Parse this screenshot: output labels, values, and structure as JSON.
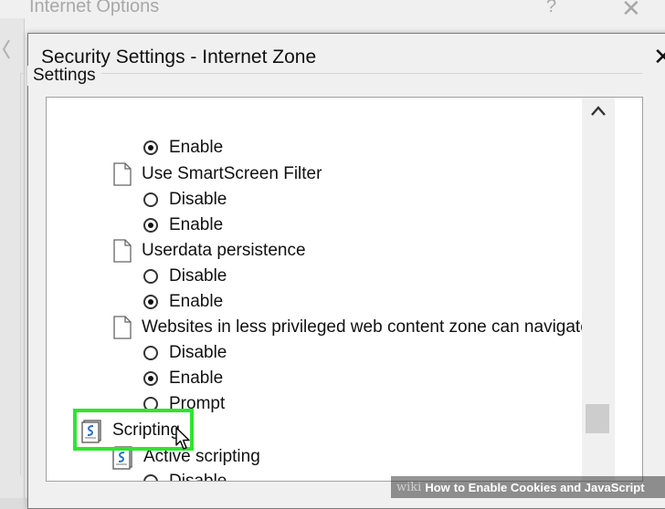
{
  "background_window": {
    "title": "Internet Options",
    "help_glyph": "?",
    "close_glyph": "✕"
  },
  "dialog": {
    "title": "Security Settings - Internet Zone",
    "close_glyph": "✕"
  },
  "settings": {
    "group_label": "Settings",
    "rows": [
      {
        "type": "radio",
        "label": "Enable",
        "checked": true
      },
      {
        "type": "setting",
        "label": "Use SmartScreen Filter"
      },
      {
        "type": "radio",
        "label": "Disable",
        "checked": false
      },
      {
        "type": "radio",
        "label": "Enable",
        "checked": true
      },
      {
        "type": "setting",
        "label": "Userdata persistence"
      },
      {
        "type": "radio",
        "label": "Disable",
        "checked": false
      },
      {
        "type": "radio",
        "label": "Enable",
        "checked": true
      },
      {
        "type": "setting",
        "label": "Websites in less privileged web content zone can navigate in"
      },
      {
        "type": "radio",
        "label": "Disable",
        "checked": false
      },
      {
        "type": "radio",
        "label": "Enable",
        "checked": true
      },
      {
        "type": "radio",
        "label": "Prompt",
        "checked": false
      },
      {
        "type": "category",
        "label": "Scripting"
      },
      {
        "type": "setting",
        "label": "Active scripting"
      },
      {
        "type": "radio",
        "label": "Disable",
        "checked": false
      }
    ]
  },
  "watermark": {
    "wiki": "wiki",
    "how": "How",
    "text": "to Enable Cookies and JavaScript"
  },
  "colors": {
    "highlight": "#2ee52e"
  }
}
